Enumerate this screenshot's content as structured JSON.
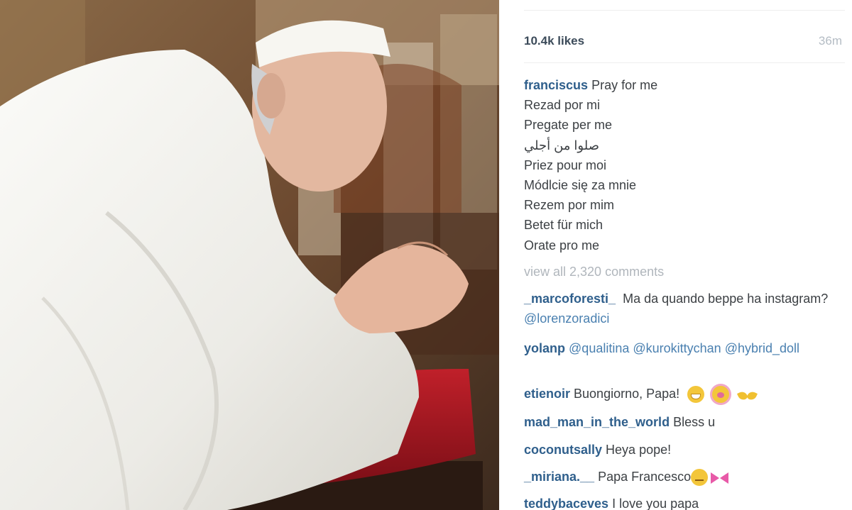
{
  "post": {
    "likes": "10.4k likes",
    "time": "36m",
    "caption": {
      "username": "franciscus",
      "lines": [
        "Pray for me",
        "Rezad por mi",
        "Pregate per me",
        "صلوا من أجلي",
        "Priez pour moi",
        "Módlcie się za mnie",
        "Rezem por mim",
        "Betet für mich",
        "Orate pro me"
      ]
    },
    "view_all": "view all 2,320 comments"
  },
  "comments": [
    {
      "username": "_marcoforesti_",
      "text": "Ma da quando beppe ha instagram?",
      "mention": "@lorenzoradici"
    },
    {
      "username": "yolanp",
      "mentions": [
        "@qualitina",
        "@kurokittychan",
        "@hybrid_doll"
      ]
    },
    {
      "username": "etienoir",
      "text": "Buongiorno, Papa!",
      "emojis": [
        "grinning-face",
        "crying-face",
        "raised-hands"
      ]
    },
    {
      "username": "mad_man_in_the_world",
      "text": "Bless u"
    },
    {
      "username": "coconutsally",
      "text": "Heya pope!"
    },
    {
      "username": "_miriana.__",
      "text": "Papa Francesco",
      "emojis": [
        "unamused-face",
        "ribbon"
      ]
    },
    {
      "username": "teddybaceves",
      "text": "I love you papa"
    }
  ],
  "colors": {
    "username": "#2f5f8c",
    "mention": "#4a80b0",
    "muted": "#b0b6bc",
    "text": "#3c4044"
  }
}
